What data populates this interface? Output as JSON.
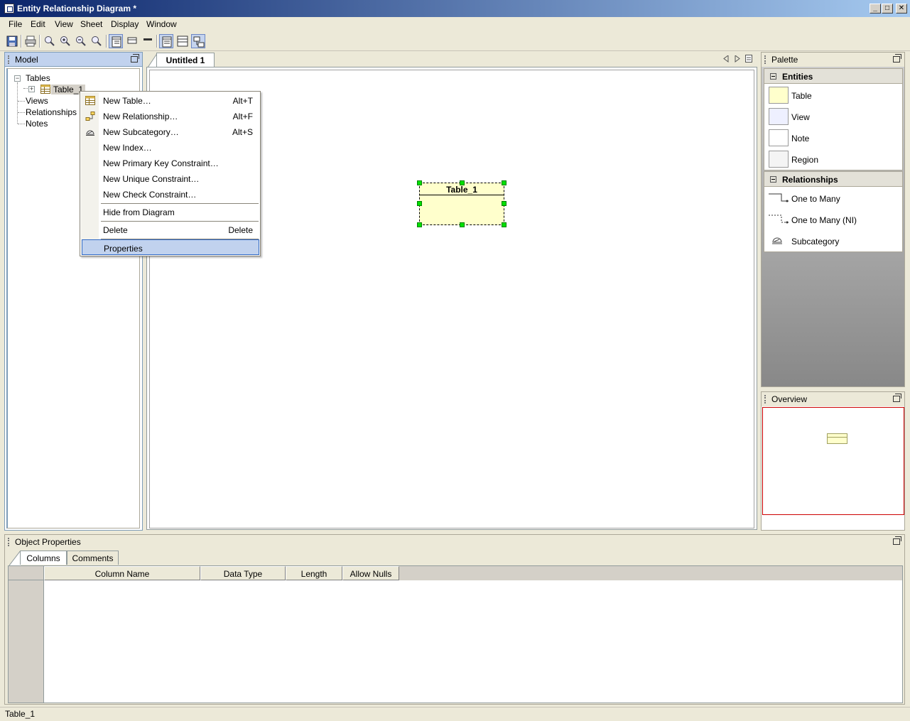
{
  "window": {
    "title": "Entity Relationship Diagram *",
    "controls": [
      "minimize",
      "maximize",
      "close"
    ]
  },
  "menu": [
    "File",
    "Edit",
    "View",
    "Sheet",
    "Display",
    "Window"
  ],
  "toolbar": {
    "buttons": [
      {
        "name": "save-icon"
      },
      {
        "name": "print-icon"
      },
      {
        "name": "zoom-icon"
      },
      {
        "name": "zoom-in-icon"
      },
      {
        "name": "zoom-out-icon"
      },
      {
        "name": "zoom-fit-icon"
      },
      {
        "name": "view-full-icon",
        "pressed": true
      },
      {
        "name": "view-compact-icon"
      },
      {
        "name": "view-header-icon"
      },
      {
        "name": "view-columns-icon",
        "pressed": true
      },
      {
        "name": "view-table-icon"
      },
      {
        "name": "auto-layout-icon",
        "pressed": true
      }
    ]
  },
  "model_panel": {
    "title": "Model",
    "tree": {
      "tables": "Tables",
      "table_1": "Table_1",
      "views": "Views",
      "relationships": "Relationships",
      "notes": "Notes"
    }
  },
  "diagram": {
    "tab": "Untitled 1",
    "entity_name": "Table_1"
  },
  "context_menu": {
    "items": [
      {
        "label": "New Table…",
        "accel": "Alt+T",
        "icon": "table-icon"
      },
      {
        "label": "New Relationship…",
        "accel": "Alt+F",
        "icon": "relationship-icon"
      },
      {
        "label": "New Subcategory…",
        "accel": "Alt+S",
        "icon": "subcategory-icon"
      },
      {
        "label": "New Index…",
        "accel": ""
      },
      {
        "label": "New Primary Key Constraint…",
        "accel": ""
      },
      {
        "label": "New Unique Constraint…",
        "accel": ""
      },
      {
        "label": "New Check Constraint…",
        "accel": ""
      },
      {
        "label": "Hide from Diagram",
        "accel": ""
      },
      {
        "label": "Delete",
        "accel": "Delete"
      },
      {
        "label": "Properties",
        "accel": "",
        "highlighted": true
      }
    ]
  },
  "palette": {
    "title": "Palette",
    "entities_header": "Entities",
    "entities": [
      "Table",
      "View",
      "Note",
      "Region"
    ],
    "relationships_header": "Relationships",
    "relationships": [
      "One to Many",
      "One to Many (NI)",
      "Subcategory"
    ]
  },
  "overview": {
    "title": "Overview"
  },
  "object_properties": {
    "title": "Object Properties",
    "tabs": [
      "Columns",
      "Comments"
    ],
    "active_tab": "Columns",
    "columns": [
      "Column Name",
      "Data Type",
      "Length",
      "Allow Nulls"
    ]
  },
  "status": {
    "text": "Table_1"
  },
  "colors": {
    "entity_fill": "#ffffcc",
    "selection_handle": "#00e000",
    "menu_highlight": "#c1d2ee",
    "title_gradient_start": "#0a246a",
    "overview_frame": "#cc0000"
  }
}
